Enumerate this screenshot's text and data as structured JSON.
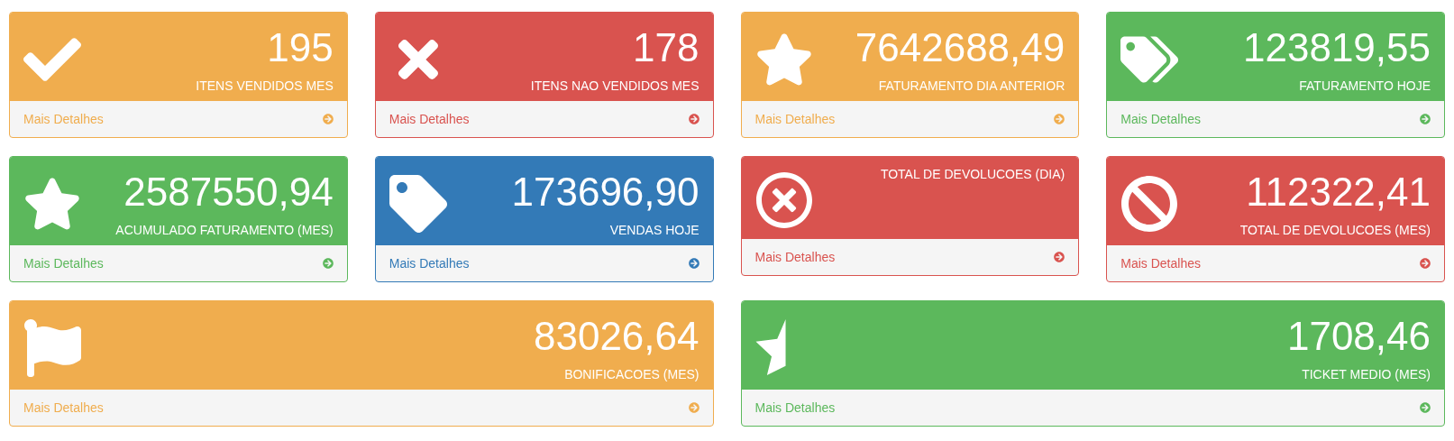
{
  "cards": [
    {
      "kind": "normal",
      "color": "#f0ad4e",
      "value": "195",
      "title": "ITENS VENDIDOS MES",
      "link": "Mais Detalhes"
    },
    {
      "kind": "normal",
      "color": "#d9534f",
      "value": "178",
      "title": "ITENS NAO VENDIDOS MES",
      "link": "Mais Detalhes"
    },
    {
      "kind": "normal",
      "color": "#f0ad4e",
      "value": "7642688,49",
      "title": "FATURAMENTO DIA ANTERIOR",
      "link": "Mais Detalhes"
    },
    {
      "kind": "normal",
      "color": "#5cb85c",
      "value": "123819,55",
      "title": "FATURAMENTO HOJE",
      "link": "Mais Detalhes"
    },
    {
      "kind": "normal",
      "color": "#5cb85c",
      "value": "2587550,94",
      "title": "ACUMULADO FATURAMENTO (MES)",
      "link": "Mais Detalhes"
    },
    {
      "kind": "normal",
      "color": "#337ab7",
      "value": "173696,90",
      "title": "VENDAS HOJE",
      "link": "Mais Detalhes"
    },
    {
      "kind": "normal",
      "color": "#d9534f",
      "title": "TOTAL DE DEVOLUCOES (DIA)",
      "link": "Mais Detalhes"
    },
    {
      "kind": "normal",
      "color": "#d9534f",
      "value": "112322,41",
      "title": "TOTAL DE DEVOLUCOES (MES)",
      "link": "Mais Detalhes"
    },
    {
      "kind": "wide",
      "color": "#f0ad4e",
      "value": "83026,64",
      "title": "BONIFICACOES (MES)",
      "link": "Mais Detalhes"
    },
    {
      "kind": "wide",
      "color": "#5cb85c",
      "value": "1708,46",
      "title": "TICKET MEDIO (MES)",
      "link": "Mais Detalhes"
    }
  ]
}
